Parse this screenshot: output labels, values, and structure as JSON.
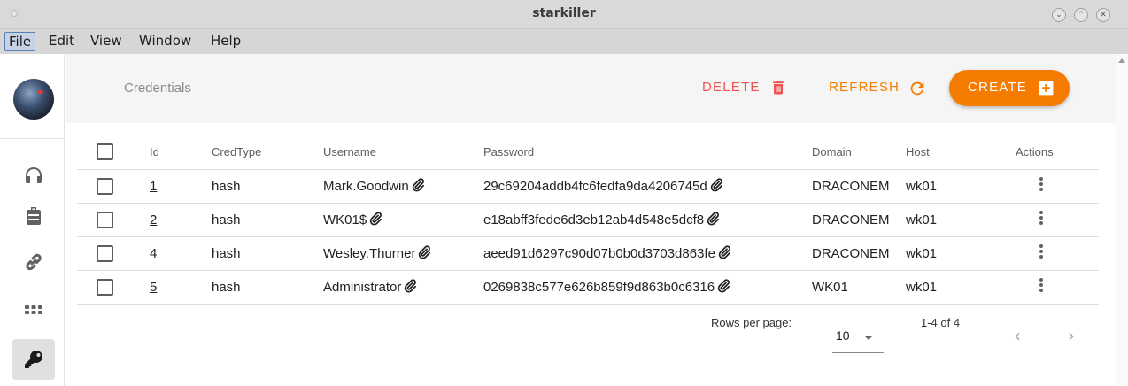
{
  "window": {
    "title": "starkiller"
  },
  "menu": [
    "File",
    "Edit",
    "View",
    "Window",
    "Help"
  ],
  "sidebar": {
    "items": [
      {
        "name": "listeners",
        "icon": "headphones-icon"
      },
      {
        "name": "stagers",
        "icon": "briefcase-icon"
      },
      {
        "name": "agents",
        "icon": "link-icon"
      },
      {
        "name": "modules",
        "icon": "apps-grid-icon"
      },
      {
        "name": "credentials",
        "icon": "key-icon",
        "selected": true
      }
    ]
  },
  "toolbar": {
    "breadcrumb": "Credentials",
    "delete_label": "DELETE",
    "refresh_label": "REFRESH",
    "create_label": "CREATE"
  },
  "table": {
    "headers": [
      "Id",
      "CredType",
      "Username",
      "Password",
      "Domain",
      "Host",
      "Actions"
    ],
    "rows": [
      {
        "id": "1",
        "credtype": "hash",
        "username": "Mark.Goodwin",
        "password": "29c69204addb4fc6fedfa9da4206745d",
        "domain": "DRACONEM",
        "host": "wk01"
      },
      {
        "id": "2",
        "credtype": "hash",
        "username": "WK01$",
        "password": "e18abff3fede6d3eb12ab4d548e5dcf8",
        "domain": "DRACONEM",
        "host": "wk01"
      },
      {
        "id": "4",
        "credtype": "hash",
        "username": "Wesley.Thurner",
        "password": "aeed91d6297c90d07b0b0d3703d863fe",
        "domain": "DRACONEM",
        "host": "wk01"
      },
      {
        "id": "5",
        "credtype": "hash",
        "username": "Administrator",
        "password": "0269838c577e626b859f9d863b0c6316",
        "domain": "WK01",
        "host": "wk01"
      }
    ]
  },
  "pagination": {
    "rows_per_page_label": "Rows per page:",
    "rows_per_page": "10",
    "range": "1-4 of 4"
  },
  "colors": {
    "delete": "#ef5350",
    "accent": "#f57c00"
  }
}
